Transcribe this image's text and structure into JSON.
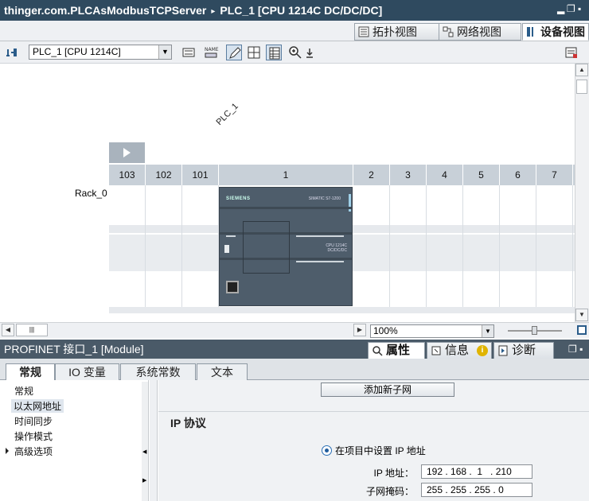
{
  "title": {
    "project": "thinger.com.PLCAsModbusTCPServer",
    "separator": "▸",
    "device": "PLC_1 [CPU 1214C DC/DC/DC]"
  },
  "window_controls": [
    "▂",
    "▪",
    "▪"
  ],
  "view_tabs": [
    {
      "label": "拓扑视图",
      "icon": "topology-icon"
    },
    {
      "label": "网络视图",
      "icon": "network-icon"
    },
    {
      "label": "设备视图",
      "icon": "device-icon",
      "active": true
    }
  ],
  "toolbar": {
    "device_select": "PLC_1 [CPU 1214C]",
    "zoom_value": "100%"
  },
  "canvas": {
    "plc_label": "PLC_1",
    "rack_label": "Rack_0",
    "slots": [
      "103",
      "102",
      "101",
      "1",
      "2",
      "3",
      "4",
      "5",
      "6",
      "7"
    ],
    "cpu_brand": "SIEMENS",
    "cpu_model": "SIMATIC S7-1200",
    "cpu_sub": "CPU 1214C\nDC/DC/DC"
  },
  "inspector": {
    "title": "PROFINET 接口_1 [Module]",
    "tabs": [
      {
        "label": "属性",
        "active": true
      },
      {
        "label": "信息",
        "badge": "i"
      },
      {
        "label": "诊断"
      }
    ],
    "sub_tabs": [
      "常规",
      "IO 变量",
      "系统常数",
      "文本"
    ],
    "active_sub_tab": "常规",
    "nav_items": [
      "常规",
      "以太网地址",
      "时间同步",
      "操作模式",
      "高级选项"
    ],
    "selected_nav": "以太网地址",
    "add_subnet_button": "添加新子网",
    "ip_section_title": "IP 协议",
    "radio_label": "在项目中设置 IP 地址",
    "ip_label": "IP 地址：",
    "ip_value": "192 . 168 .  1   . 210",
    "mask_label": "子网掩码：",
    "mask_value": "255 . 255 . 255 . 0"
  }
}
